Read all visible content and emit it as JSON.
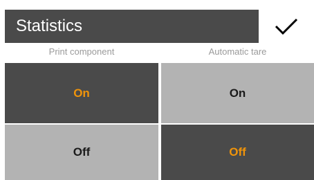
{
  "header": {
    "title": "Statistics",
    "confirm_icon": "checkmark-icon"
  },
  "settings": [
    {
      "label": "Print component",
      "options": [
        {
          "label": "On",
          "selected": true
        },
        {
          "label": "Off",
          "selected": false
        }
      ]
    },
    {
      "label": "Automatic tare",
      "options": [
        {
          "label": "On",
          "selected": false
        },
        {
          "label": "Off",
          "selected": true
        }
      ]
    }
  ],
  "colors": {
    "dark": "#4a4a4a",
    "light": "#b3b3b3",
    "accent": "#f0940a",
    "label": "#9a9a9a"
  }
}
